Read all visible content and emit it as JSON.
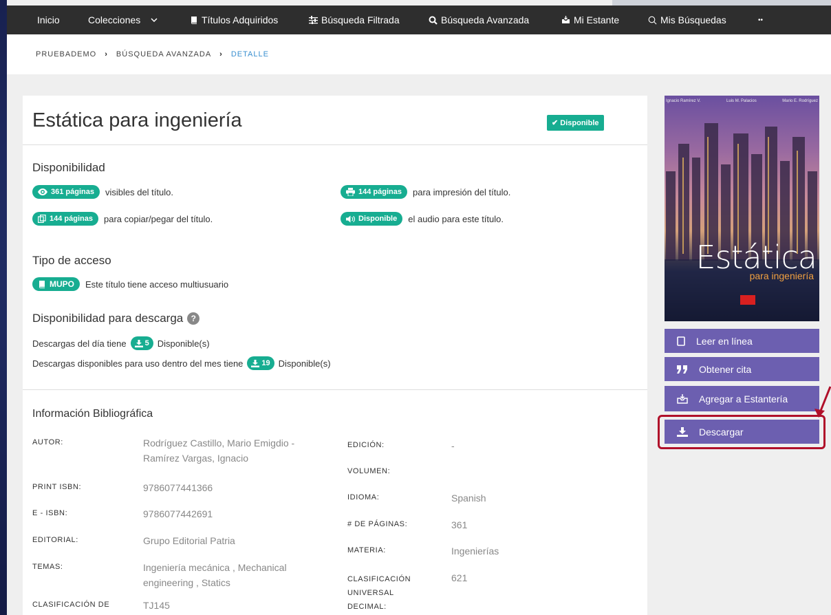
{
  "nav": {
    "inicio": "Inicio",
    "colecciones": "Colecciones",
    "titulos": "Títulos Adquiridos",
    "filtrada": "Búsqueda Filtrada",
    "avanzada": "Búsqueda Avanzada",
    "estante": "Mi Estante",
    "busquedas": "Mis Búsquedas",
    "more": "••"
  },
  "breadcrumb": {
    "item1": "PRUEBADEMO",
    "item2": "BÚSQUEDA AVANZADA",
    "item3": "DETALLE"
  },
  "book": {
    "title": "Estática para ingeniería",
    "status": "Disponible"
  },
  "availability": {
    "heading": "Disponibilidad",
    "pages_visible_pill": "361 páginas",
    "pages_visible_text": "visibles del título.",
    "pages_print_pill": "144 páginas",
    "pages_print_text": "para impresión del título.",
    "pages_copy_pill": "144 páginas",
    "pages_copy_text": "para copiar/pegar del título.",
    "audio_pill": "Disponible",
    "audio_text": "el audio para este título."
  },
  "access": {
    "heading": "Tipo de acceso",
    "pill": "MUPO",
    "text": "Este título tiene acceso multiusuario"
  },
  "download": {
    "heading": "Disponibilidad para descarga",
    "help": "?",
    "day_prefix": "Descargas del día tiene",
    "day_count": "5",
    "day_suffix": "Disponible(s)",
    "month_prefix": "Descargas disponibles para uso dentro del mes tiene",
    "month_count": "19",
    "month_suffix": "Disponible(s)"
  },
  "bib": {
    "heading": "Información Bibliográfica",
    "autor_label": "AUTOR:",
    "autor_line1": "Rodríguez Castillo, Mario Emigdio -",
    "autor_line2": "Ramírez Vargas, Ignacio",
    "print_isbn_label": "PRINT ISBN:",
    "print_isbn": "9786077441366",
    "eisbn_label": "E - ISBN:",
    "eisbn": "9786077442691",
    "editorial_label": "EDITORIAL:",
    "editorial": "Grupo Editorial Patria",
    "temas_label": "TEMAS:",
    "temas_line1": "Ingeniería mecánica , Mechanical",
    "temas_line2": "engineering , Statics",
    "clasif_bib_label": "CLASIFICACIÓN DE",
    "clasif_bib": "TJ145",
    "edicion_label": "EDICIÓN:",
    "edicion": "-",
    "volumen_label": "VOLUMEN:",
    "idioma_label": "IDIOMA:",
    "idioma": "Spanish",
    "paginas_label": "# DE PÁGINAS:",
    "paginas": "361",
    "materia_label": "MATERIA:",
    "materia": "Ingenierías",
    "cdu_label1": "CLASIFICACIÓN",
    "cdu_label2": "UNIVERSAL",
    "cdu_label3": "DECIMAL:",
    "cdu": "621"
  },
  "cover": {
    "author1": "Ignacio Ramírez V.",
    "author2": "Luis M. Palacios",
    "author3": "Mario E. Rodríguez",
    "title": "Estática",
    "subtitle": "para ingeniería"
  },
  "actions": {
    "read": "Leer en línea",
    "cite": "Obtener cita",
    "shelf": "Agregar a Estantería",
    "download": "Descargar"
  },
  "colors": {
    "accent_green": "#17ad91",
    "action_purple": "#6c5fb0",
    "highlight_red": "#b0102a"
  }
}
